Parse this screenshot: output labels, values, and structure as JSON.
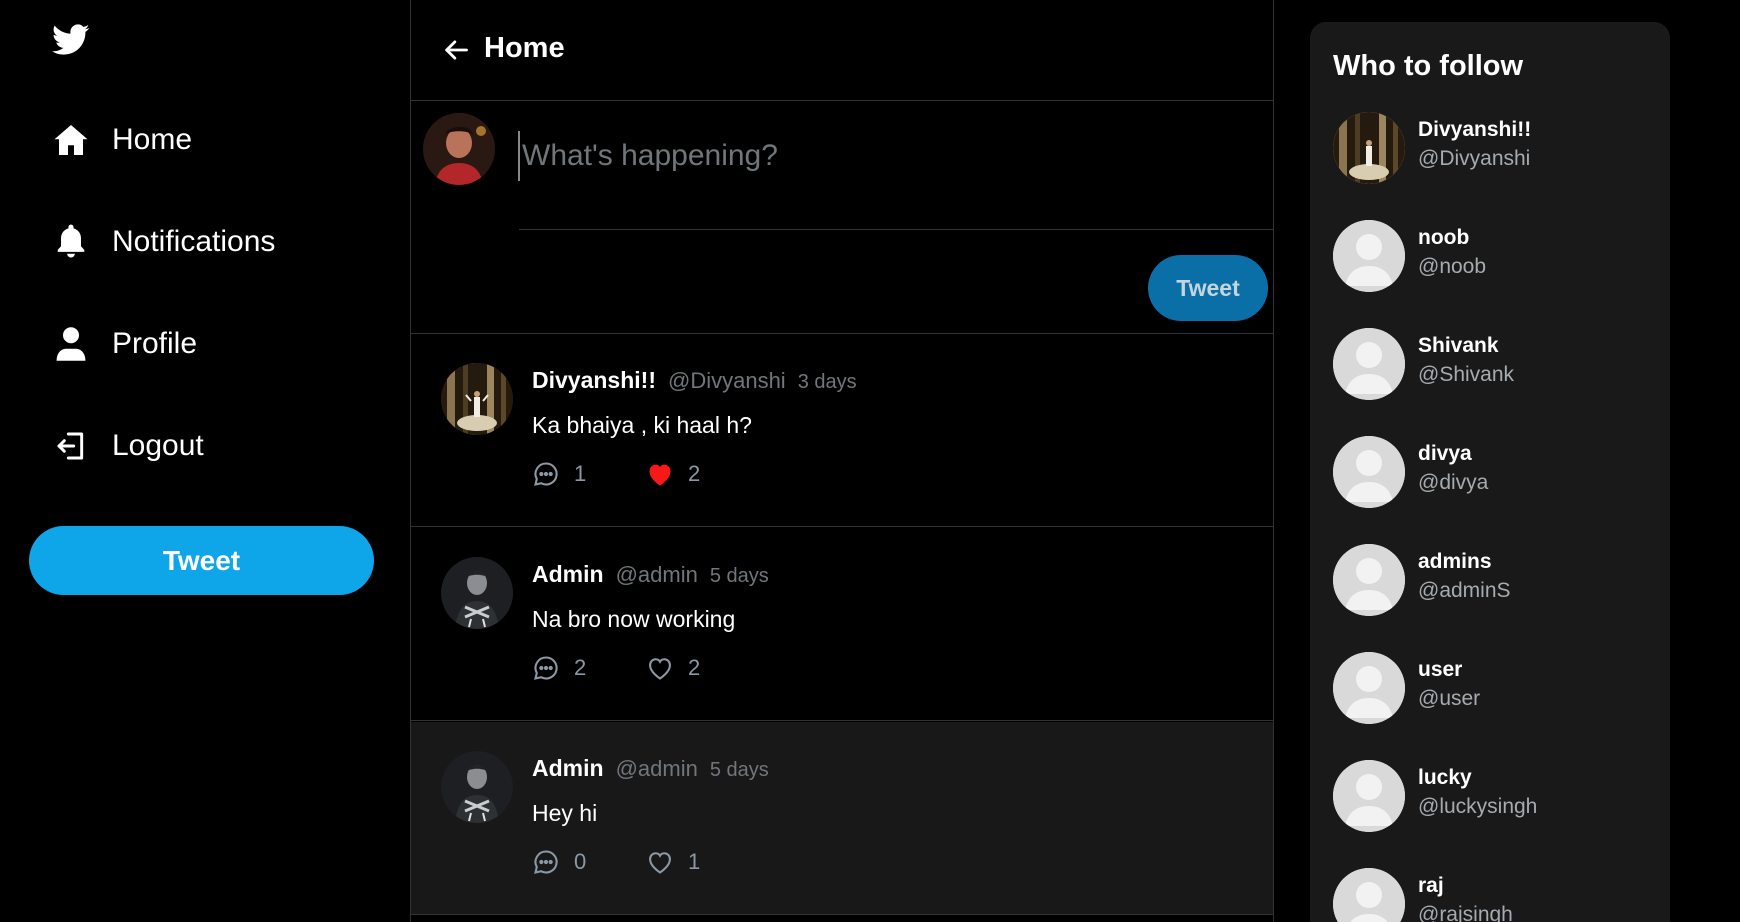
{
  "sidebar": {
    "logo_icon": "twitter-bird-icon",
    "items": [
      {
        "label": "Home",
        "icon": "home-icon"
      },
      {
        "label": "Notifications",
        "icon": "bell-icon"
      },
      {
        "label": "Profile",
        "icon": "user-icon"
      },
      {
        "label": "Logout",
        "icon": "logout-icon"
      }
    ],
    "tweet_label": "Tweet"
  },
  "header": {
    "title": "Home",
    "back_icon": "arrow-left-icon"
  },
  "composer": {
    "placeholder": "What's happening?",
    "tweet_label": "Tweet"
  },
  "posts": [
    {
      "name": "Divyanshi!!",
      "handle": "@Divyanshi",
      "time": "3 days",
      "text": "Ka bhaiya , ki haal h?",
      "replies": "1",
      "likes": "2",
      "liked": true
    },
    {
      "name": "Admin",
      "handle": "@admin",
      "time": "5 days",
      "text": "Na bro now working",
      "replies": "2",
      "likes": "2",
      "liked": false
    },
    {
      "name": "Admin",
      "handle": "@admin",
      "time": "5 days",
      "text": "Hey hi",
      "replies": "0",
      "likes": "1",
      "liked": false
    }
  ],
  "who_to_follow": {
    "title": "Who to follow",
    "users": [
      {
        "name": "Divyanshi!!",
        "handle": "@Divyanshi"
      },
      {
        "name": "noob",
        "handle": "@noob"
      },
      {
        "name": "Shivank",
        "handle": "@Shivank"
      },
      {
        "name": "divya",
        "handle": "@divya"
      },
      {
        "name": "admins",
        "handle": "@adminS"
      },
      {
        "name": "user",
        "handle": "@user"
      },
      {
        "name": "lucky",
        "handle": "@luckysingh"
      },
      {
        "name": "raj",
        "handle": "@rajsingh"
      }
    ]
  },
  "colors": {
    "accent": "#0ea5e9",
    "like_active": "#f91818",
    "muted_text": "#71767b",
    "panel_bg": "#191919"
  }
}
